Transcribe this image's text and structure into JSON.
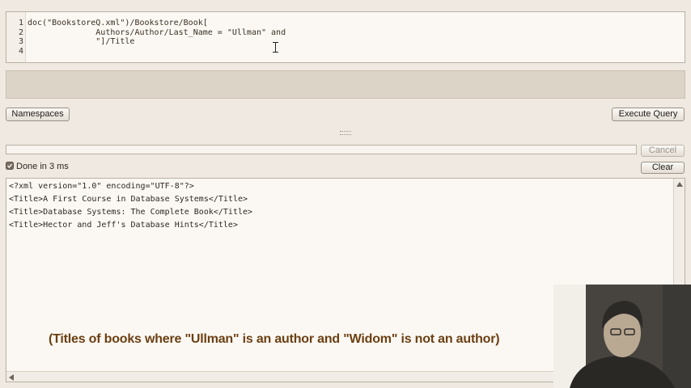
{
  "editor": {
    "line_numbers": [
      "1",
      "2",
      "3",
      "4"
    ],
    "lines": [
      "doc(\"BookstoreQ.xml\")/Bookstore/Book[",
      "              Authors/Author/Last_Name = \"Ullman\" and",
      "              \"]/Title",
      ""
    ]
  },
  "toolbar": {
    "namespaces_label": "Namespaces",
    "execute_label": "Execute Query"
  },
  "run": {
    "cancel_label": "Cancel",
    "clear_label": "Clear",
    "status_text": "Done in 3 ms"
  },
  "results": {
    "lines": [
      "<?xml version=\"1.0\" encoding=\"UTF-8\"?>",
      "<Title>A First Course in Database Systems</Title>",
      "<Title>Database Systems: The Complete Book</Title>",
      "<Title>Hector and Jeff's Database Hints</Title>"
    ]
  },
  "caption": "(Titles of books where \"Ullman\" is an author and \"Widom\" is not an author)",
  "colors": {
    "background": "#efe9e1",
    "caption": "#6b3f12",
    "status_ok": "#2f7d2f"
  }
}
